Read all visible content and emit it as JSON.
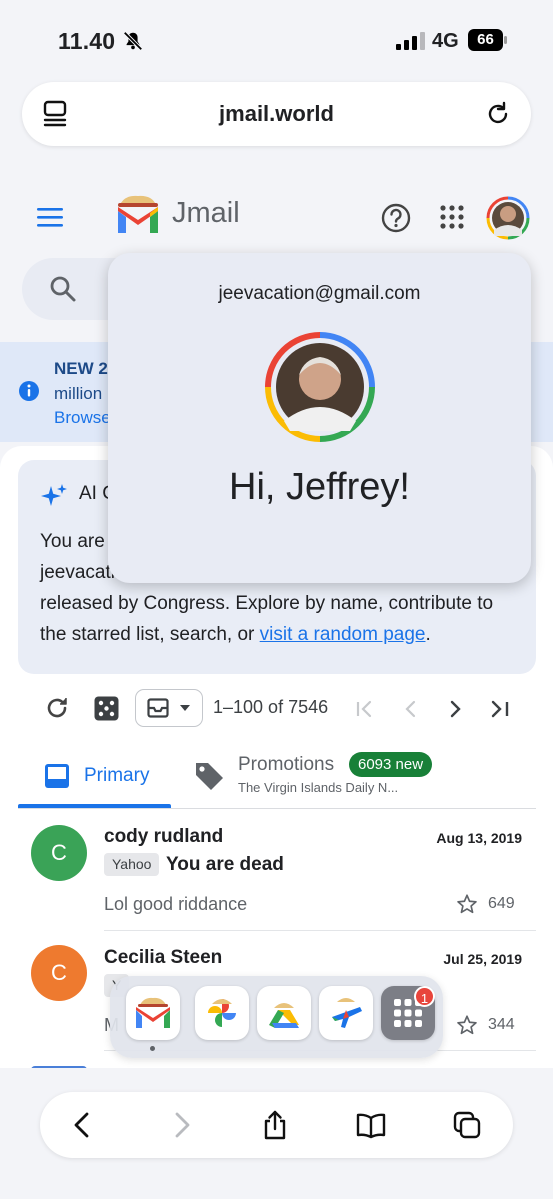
{
  "status_bar": {
    "time": "11.40",
    "network": "4G",
    "battery": "66"
  },
  "browser": {
    "url": "jmail.world"
  },
  "app": {
    "brand": "Jmail"
  },
  "banner": {
    "title": "NEW 2,",
    "line2": "million",
    "line3": "Browse"
  },
  "ai_card": {
    "title": "AI C",
    "lines": [
      "You are",
      "jeevacati",
      "released by Congress. Explore by name, contribute to",
      "the starred list, search, or "
    ],
    "link": "visit a random page",
    "tail": "."
  },
  "toolbar": {
    "range": "1–100 of 7546"
  },
  "tabs": {
    "primary": "Primary",
    "promotions": "Promotions",
    "promotions_sub": "The Virgin Islands Daily N...",
    "promotions_badge": "6093 new"
  },
  "emails": [
    {
      "initial": "C",
      "sender": "cody rudland",
      "date": "Aug 13, 2019",
      "tag": "Yahoo",
      "subject": "You are dead",
      "snippet": "Lol good riddance",
      "stars": "649",
      "color": "#3aa357"
    },
    {
      "initial": "C",
      "sender": "Cecilia Steen",
      "date": "Jul 25, 2019",
      "tag": "Y",
      "subject": "",
      "snippet": "M",
      "stars": "344",
      "color": "#ee7a2f"
    }
  ],
  "popover": {
    "email": "jeevacation@gmail.com",
    "greeting": "Hi, Jeffrey!"
  },
  "dock": {
    "apps": [
      "gmail-app",
      "photos-app",
      "drive-app",
      "flights-app",
      "more-apps"
    ],
    "badge": "1"
  },
  "icons": {
    "tabs": "tabs-icon",
    "reload": "reload-icon",
    "menu": "menu-icon",
    "help": "help-icon",
    "apps": "apps-grid-icon",
    "search": "search-icon",
    "info": "info-icon",
    "sparkle": "sparkle-icon"
  }
}
